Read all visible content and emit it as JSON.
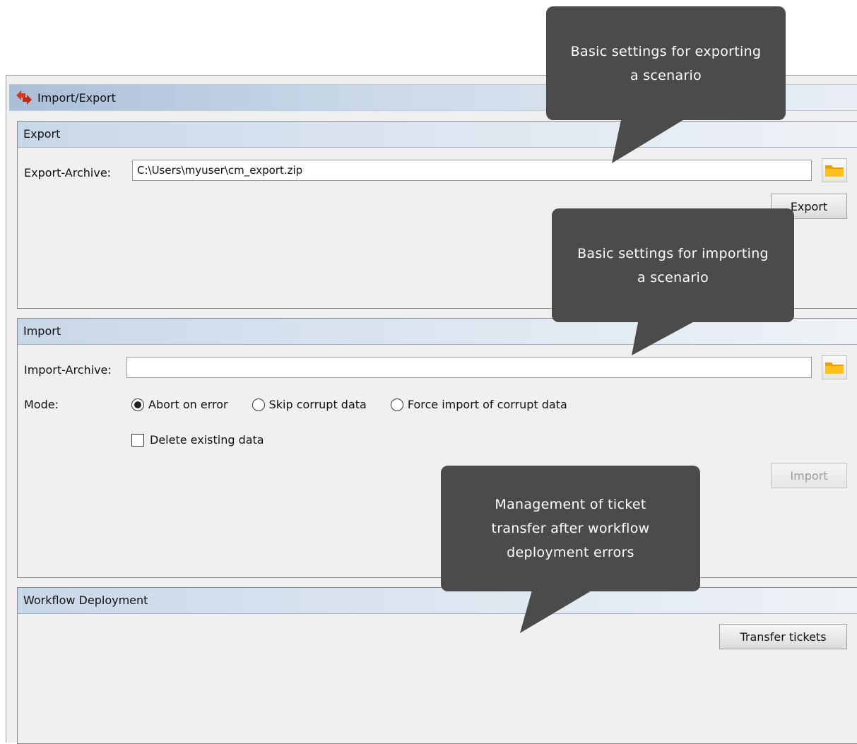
{
  "window": {
    "title": "Import/Export",
    "icon": "swap-arrows-icon"
  },
  "export": {
    "header": "Export",
    "archive_label": "Export-Archive:",
    "archive_value": "C:\\Users\\myuser\\cm_export.zip",
    "button_label": "Export"
  },
  "import": {
    "header": "Import",
    "archive_label": "Import-Archive:",
    "archive_value": "",
    "mode_label": "Mode:",
    "modes": [
      {
        "label": "Abort on error",
        "selected": true
      },
      {
        "label": "Skip corrupt data",
        "selected": false
      },
      {
        "label": "Force import of corrupt data",
        "selected": false
      }
    ],
    "delete_label": "Delete existing data",
    "delete_checked": false,
    "button_label": "Import",
    "button_enabled": false
  },
  "workflow": {
    "header": "Workflow Deployment",
    "button_label": "Transfer tickets"
  },
  "tooltips": {
    "export_tip_line1": "Basic settings for exporting",
    "export_tip_line2": "a scenario",
    "import_tip_line1": "Basic settings for importing",
    "import_tip_line2": "a scenario",
    "workflow_tip_line1": "Management of ticket",
    "workflow_tip_line2": "transfer after workflow",
    "workflow_tip_line3": "deployment errors"
  },
  "colors": {
    "tooltip_bg": "#4b4b4b",
    "folder_icon": "#f5b400",
    "app_icon": "#d9361e"
  }
}
